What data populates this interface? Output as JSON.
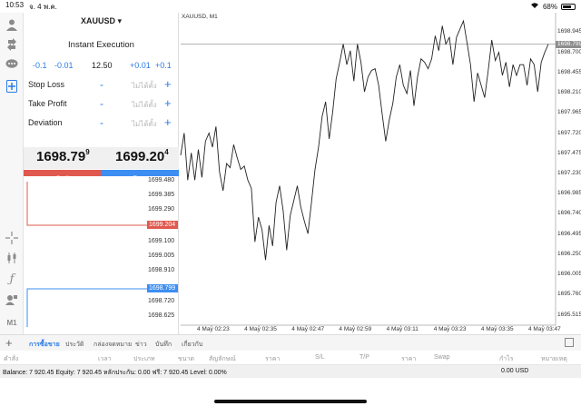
{
  "statusbar": {
    "time": "10:53",
    "date": "จ. 4 พ.ค.",
    "battery": "68%"
  },
  "order_panel": {
    "symbol": "XAUUSD",
    "execution": "Instant Execution",
    "volume_steps": [
      "-0.1",
      "-0.01",
      "12.50",
      "+0.01",
      "+0.1"
    ],
    "stop_loss_label": "Stop Loss",
    "take_profit_label": "Take Profit",
    "deviation_label": "Deviation",
    "unset_value": "ไม่ได้ตั้ง",
    "minus": "-",
    "plus": "+",
    "sell_price_main": "1698.79",
    "sell_price_sup": "9",
    "buy_price_main": "1699.20",
    "buy_price_sup": "4",
    "sell_label": "Sell",
    "buy_label": "Buy"
  },
  "tick_chart": {
    "price_labels": [
      "1699.480",
      "1699.385",
      "1699.290",
      "1699.100",
      "1699.005",
      "1698.910",
      "1698.720",
      "1698.625"
    ],
    "ask_badge": "1699.204",
    "bid_badge": "1698.799",
    "colors": {
      "ask": "#e0594f",
      "bid": "#3d8ef2"
    }
  },
  "chart_data": {
    "type": "line",
    "title": "XAUUSD, M1",
    "x_ticks": [
      "4 May 02:23",
      "4 May 02:35",
      "4 May 02:47",
      "4 May 02:59",
      "4 May 03:11",
      "4 May 03:23",
      "4 May 03:35",
      "4 May 03:47"
    ],
    "y_ticks": [
      "1698.945",
      "1698.700",
      "1698.455",
      "1698.210",
      "1697.965",
      "1697.720",
      "1697.475",
      "1697.230",
      "1696.985",
      "1696.740",
      "1696.495",
      "1696.250",
      "1696.005",
      "1695.760",
      "1695.515"
    ],
    "ylim": [
      1695.39,
      1699.07
    ],
    "current_price": "1698.799",
    "values": [
      1697.45,
      1697.72,
      1697.15,
      1697.48,
      1697.15,
      1697.52,
      1697.18,
      1697.62,
      1697.72,
      1697.55,
      1697.8,
      1697.25,
      1697.02,
      1697.35,
      1697.3,
      1697.58,
      1697.42,
      1697.28,
      1697.32,
      1697.15,
      1697.05,
      1696.4,
      1696.7,
      1696.55,
      1696.18,
      1696.6,
      1696.35,
      1696.88,
      1697.08,
      1696.78,
      1696.3,
      1696.72,
      1696.9,
      1697.08,
      1696.82,
      1696.65,
      1696.5,
      1696.88,
      1697.28,
      1697.55,
      1697.92,
      1698.1,
      1697.65,
      1697.98,
      1698.38,
      1698.58,
      1698.8,
      1698.55,
      1698.72,
      1698.35,
      1698.8,
      1698.58,
      1698.22,
      1698.4,
      1698.48,
      1698.5,
      1698.3,
      1697.95,
      1697.62,
      1697.88,
      1698.08,
      1698.4,
      1698.55,
      1698.3,
      1698.2,
      1698.48,
      1698.05,
      1698.4,
      1698.62,
      1698.58,
      1698.5,
      1698.62,
      1698.9,
      1698.72,
      1699.02,
      1698.8,
      1698.88,
      1698.55,
      1698.88,
      1698.98,
      1699.08,
      1698.82,
      1698.55,
      1698.1,
      1698.45,
      1698.3,
      1698.15,
      1698.48,
      1698.85,
      1698.6,
      1698.7,
      1698.42,
      1698.58,
      1698.28,
      1698.55,
      1698.42,
      1698.55,
      1698.55,
      1698.3,
      1698.62,
      1698.55,
      1698.22,
      1698.58,
      1698.7,
      1698.8
    ]
  },
  "bottom_tabs": {
    "items": [
      "การซื้อขาย",
      "ประวัติ",
      "กล่องจดหมาย",
      "ข่าว",
      "บันทึก",
      "เกี่ยวกับ"
    ],
    "active": 0
  },
  "columns": [
    "คำสั่ง",
    "เวลา",
    "ประเภท",
    "ขนาด",
    "สัญลักษณ์",
    "ราคา",
    "S/L",
    "T/P",
    "ราคา",
    "Swap",
    "กำไร",
    "หมายเหตุ"
  ],
  "account": {
    "summary": "Balance: 7 920.45 Equity: 7 920.45 หลักประกัน: 0.00 ฟรี: 7 920.45 Level: 0.00%",
    "total": "0.00  USD"
  }
}
